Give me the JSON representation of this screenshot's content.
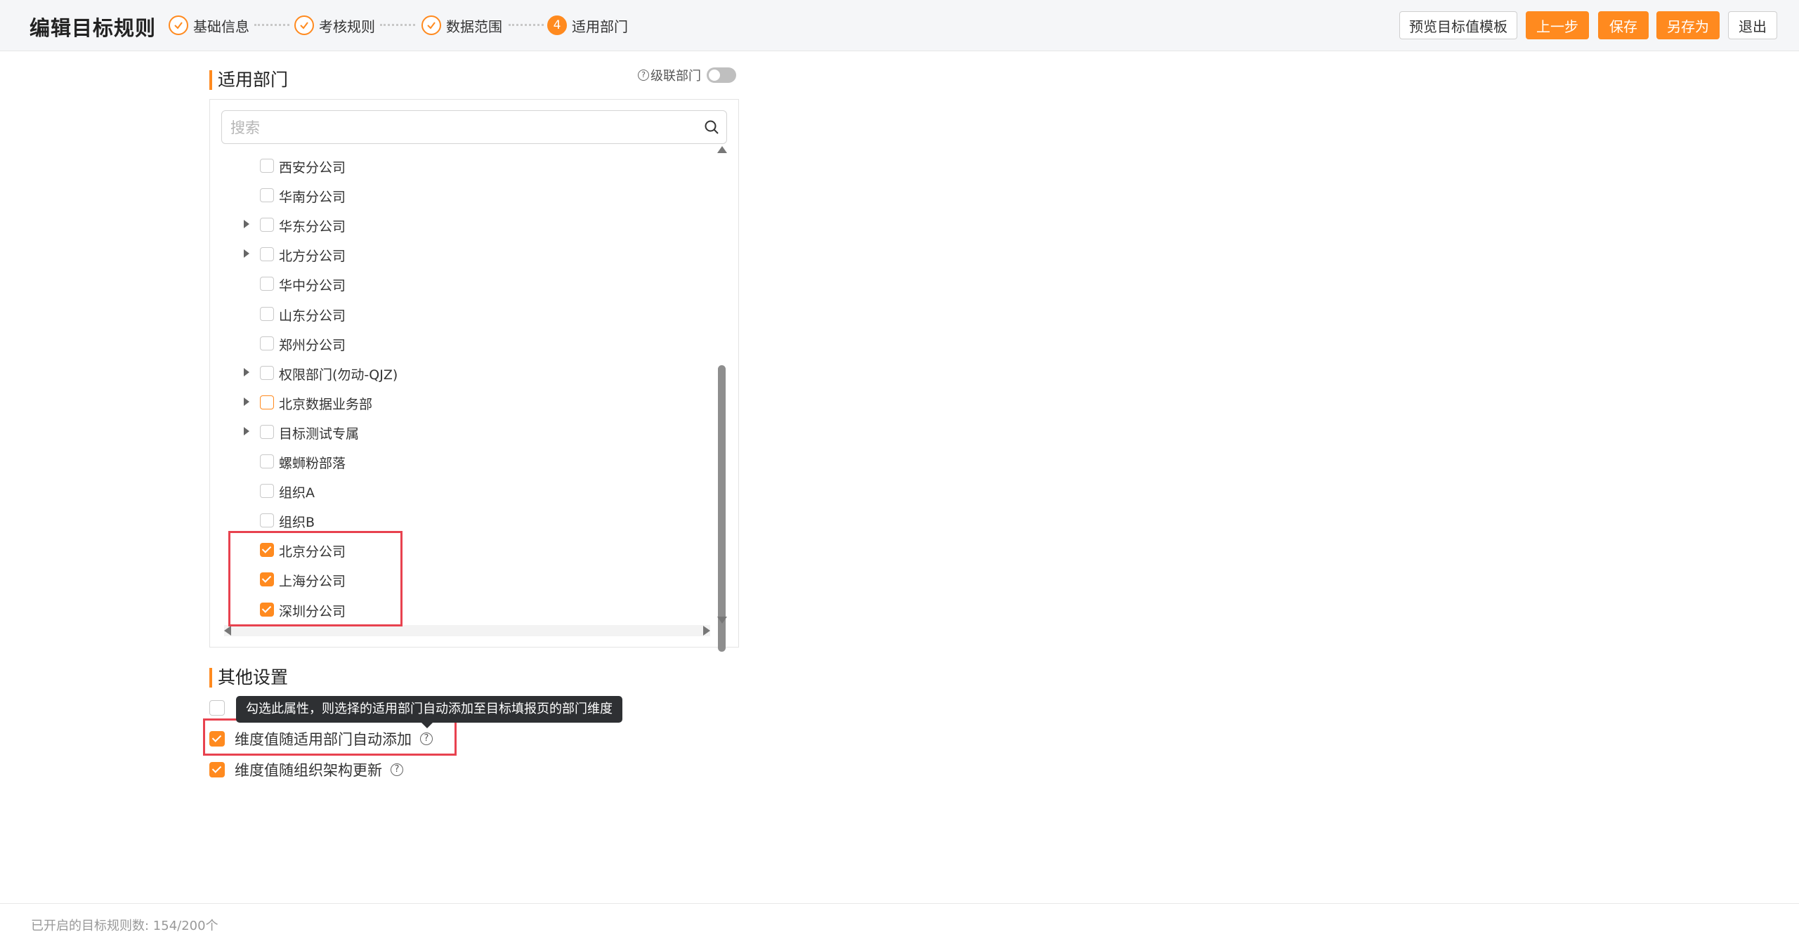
{
  "header": {
    "title": "编辑目标规则",
    "steps": [
      {
        "label": "基础信息",
        "state": "done"
      },
      {
        "label": "考核规则",
        "state": "done"
      },
      {
        "label": "数据范围",
        "state": "done"
      },
      {
        "label": "适用部门",
        "state": "active",
        "number": "4"
      }
    ],
    "buttons": {
      "preview": "预览目标值模板",
      "prev": "上一步",
      "save": "保存",
      "save_as": "另存为",
      "exit": "退出"
    }
  },
  "departments": {
    "title": "适用部门",
    "cascade_label": "级联部门",
    "cascade_help": "?",
    "cascade_on": false,
    "search_placeholder": "搜索",
    "nodes": [
      {
        "label": "西安分公司",
        "expandable": false,
        "checked": false
      },
      {
        "label": "华南分公司",
        "expandable": false,
        "checked": false
      },
      {
        "label": "华东分公司",
        "expandable": true,
        "checked": false
      },
      {
        "label": "北方分公司",
        "expandable": true,
        "checked": false
      },
      {
        "label": "华中分公司",
        "expandable": false,
        "checked": false
      },
      {
        "label": "山东分公司",
        "expandable": false,
        "checked": false
      },
      {
        "label": "郑州分公司",
        "expandable": false,
        "checked": false
      },
      {
        "label": "权限部门(勿动-QJZ)",
        "expandable": true,
        "checked": false
      },
      {
        "label": "北京数据业务部",
        "expandable": true,
        "checked": false,
        "partial": true
      },
      {
        "label": "目标测试专属",
        "expandable": true,
        "checked": false
      },
      {
        "label": "螺蛳粉部落",
        "expandable": false,
        "checked": false
      },
      {
        "label": "组织A",
        "expandable": false,
        "checked": false
      },
      {
        "label": "组织B",
        "expandable": false,
        "checked": false
      },
      {
        "label": "北京分公司",
        "expandable": false,
        "checked": true
      },
      {
        "label": "上海分公司",
        "expandable": false,
        "checked": true
      },
      {
        "label": "深圳分公司",
        "expandable": false,
        "checked": true
      }
    ]
  },
  "other_settings": {
    "title": "其他设置",
    "options": [
      {
        "label": "",
        "checked": false
      },
      {
        "label": "维度值随适用部门自动添加",
        "checked": true
      },
      {
        "label": "维度值随组织架构更新",
        "checked": true
      }
    ],
    "help_glyph": "?",
    "tooltip": "勾选此属性，则选择的适用部门自动添加至目标填报页的部门维度"
  },
  "footer": {
    "rule_count": "已开启的目标规则数: 154/200个"
  },
  "colors": {
    "accent": "#ff8a1f",
    "highlight": "#e8424f",
    "tooltip_bg": "#2e3033"
  }
}
